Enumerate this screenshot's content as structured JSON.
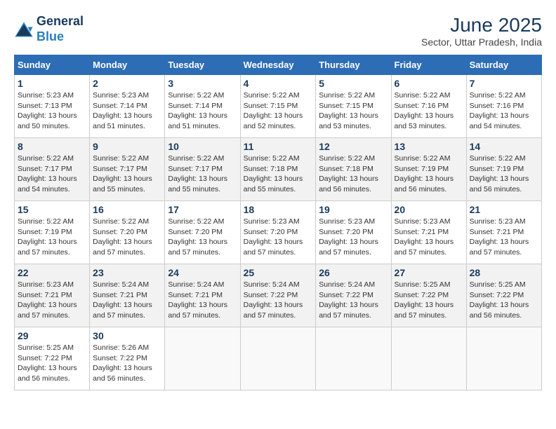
{
  "header": {
    "logo_line1": "General",
    "logo_line2": "Blue",
    "month_year": "June 2025",
    "location": "Sector, Uttar Pradesh, India"
  },
  "days_of_week": [
    "Sunday",
    "Monday",
    "Tuesday",
    "Wednesday",
    "Thursday",
    "Friday",
    "Saturday"
  ],
  "weeks": [
    [
      {
        "day": "1",
        "info": "Sunrise: 5:23 AM\nSunset: 7:13 PM\nDaylight: 13 hours\nand 50 minutes."
      },
      {
        "day": "2",
        "info": "Sunrise: 5:23 AM\nSunset: 7:14 PM\nDaylight: 13 hours\nand 51 minutes."
      },
      {
        "day": "3",
        "info": "Sunrise: 5:22 AM\nSunset: 7:14 PM\nDaylight: 13 hours\nand 51 minutes."
      },
      {
        "day": "4",
        "info": "Sunrise: 5:22 AM\nSunset: 7:15 PM\nDaylight: 13 hours\nand 52 minutes."
      },
      {
        "day": "5",
        "info": "Sunrise: 5:22 AM\nSunset: 7:15 PM\nDaylight: 13 hours\nand 53 minutes."
      },
      {
        "day": "6",
        "info": "Sunrise: 5:22 AM\nSunset: 7:16 PM\nDaylight: 13 hours\nand 53 minutes."
      },
      {
        "day": "7",
        "info": "Sunrise: 5:22 AM\nSunset: 7:16 PM\nDaylight: 13 hours\nand 54 minutes."
      }
    ],
    [
      {
        "day": "8",
        "info": "Sunrise: 5:22 AM\nSunset: 7:17 PM\nDaylight: 13 hours\nand 54 minutes."
      },
      {
        "day": "9",
        "info": "Sunrise: 5:22 AM\nSunset: 7:17 PM\nDaylight: 13 hours\nand 55 minutes."
      },
      {
        "day": "10",
        "info": "Sunrise: 5:22 AM\nSunset: 7:17 PM\nDaylight: 13 hours\nand 55 minutes."
      },
      {
        "day": "11",
        "info": "Sunrise: 5:22 AM\nSunset: 7:18 PM\nDaylight: 13 hours\nand 55 minutes."
      },
      {
        "day": "12",
        "info": "Sunrise: 5:22 AM\nSunset: 7:18 PM\nDaylight: 13 hours\nand 56 minutes."
      },
      {
        "day": "13",
        "info": "Sunrise: 5:22 AM\nSunset: 7:19 PM\nDaylight: 13 hours\nand 56 minutes."
      },
      {
        "day": "14",
        "info": "Sunrise: 5:22 AM\nSunset: 7:19 PM\nDaylight: 13 hours\nand 56 minutes."
      }
    ],
    [
      {
        "day": "15",
        "info": "Sunrise: 5:22 AM\nSunset: 7:19 PM\nDaylight: 13 hours\nand 57 minutes."
      },
      {
        "day": "16",
        "info": "Sunrise: 5:22 AM\nSunset: 7:20 PM\nDaylight: 13 hours\nand 57 minutes."
      },
      {
        "day": "17",
        "info": "Sunrise: 5:22 AM\nSunset: 7:20 PM\nDaylight: 13 hours\nand 57 minutes."
      },
      {
        "day": "18",
        "info": "Sunrise: 5:23 AM\nSunset: 7:20 PM\nDaylight: 13 hours\nand 57 minutes."
      },
      {
        "day": "19",
        "info": "Sunrise: 5:23 AM\nSunset: 7:20 PM\nDaylight: 13 hours\nand 57 minutes."
      },
      {
        "day": "20",
        "info": "Sunrise: 5:23 AM\nSunset: 7:21 PM\nDaylight: 13 hours\nand 57 minutes."
      },
      {
        "day": "21",
        "info": "Sunrise: 5:23 AM\nSunset: 7:21 PM\nDaylight: 13 hours\nand 57 minutes."
      }
    ],
    [
      {
        "day": "22",
        "info": "Sunrise: 5:23 AM\nSunset: 7:21 PM\nDaylight: 13 hours\nand 57 minutes."
      },
      {
        "day": "23",
        "info": "Sunrise: 5:24 AM\nSunset: 7:21 PM\nDaylight: 13 hours\nand 57 minutes."
      },
      {
        "day": "24",
        "info": "Sunrise: 5:24 AM\nSunset: 7:21 PM\nDaylight: 13 hours\nand 57 minutes."
      },
      {
        "day": "25",
        "info": "Sunrise: 5:24 AM\nSunset: 7:22 PM\nDaylight: 13 hours\nand 57 minutes."
      },
      {
        "day": "26",
        "info": "Sunrise: 5:24 AM\nSunset: 7:22 PM\nDaylight: 13 hours\nand 57 minutes."
      },
      {
        "day": "27",
        "info": "Sunrise: 5:25 AM\nSunset: 7:22 PM\nDaylight: 13 hours\nand 57 minutes."
      },
      {
        "day": "28",
        "info": "Sunrise: 5:25 AM\nSunset: 7:22 PM\nDaylight: 13 hours\nand 56 minutes."
      }
    ],
    [
      {
        "day": "29",
        "info": "Sunrise: 5:25 AM\nSunset: 7:22 PM\nDaylight: 13 hours\nand 56 minutes."
      },
      {
        "day": "30",
        "info": "Sunrise: 5:26 AM\nSunset: 7:22 PM\nDaylight: 13 hours\nand 56 minutes."
      },
      null,
      null,
      null,
      null,
      null
    ]
  ]
}
